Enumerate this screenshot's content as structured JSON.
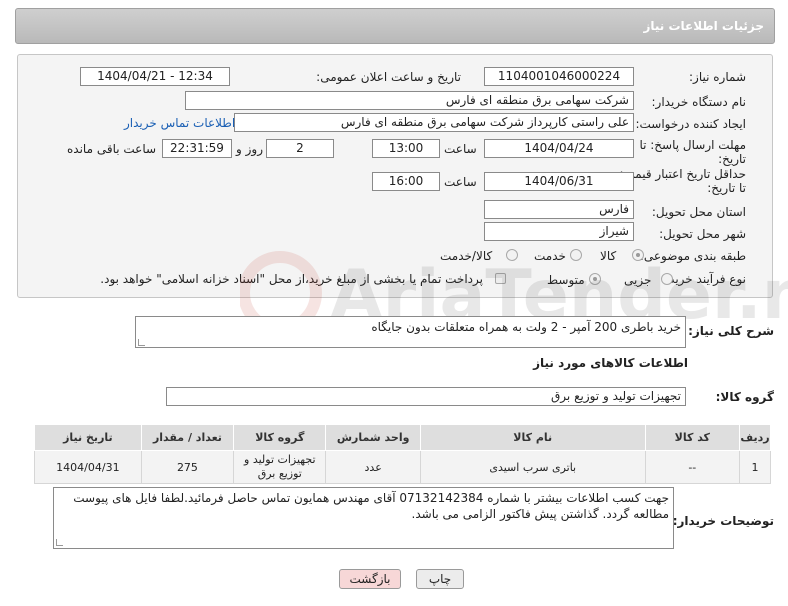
{
  "header": {
    "title": "جزئیات اطلاعات نیاز"
  },
  "form": {
    "need_number_label": "شماره نیاز:",
    "need_number": "1104001046000224",
    "announce_label": "تاریخ و ساعت اعلان عمومی:",
    "announce_value": "1404/04/21 - 12:34",
    "buyer_org_label": "نام دستگاه خریدار:",
    "buyer_org": "شرکت سهامی برق منطقه ای فارس",
    "creator_label": "ایجاد کننده درخواست:",
    "creator": "علی راستی کارپرداز شرکت سهامی برق منطقه ای فارس",
    "contact_link": "اطلاعات تماس خریدار",
    "deadline_label_1": "مهلت ارسال پاسخ: تا",
    "deadline_label_2": "تاریخ:",
    "deadline_date": "1404/04/24",
    "time_label": "ساعت",
    "deadline_time": "13:00",
    "days_value": "2",
    "days_label": "روز و",
    "remaining_time": "22:31:59",
    "remaining_label": "ساعت باقی مانده",
    "validity_label_1": "حداقل تاریخ اعتبار قیمت:",
    "validity_label_2": "تا تاریخ:",
    "validity_date": "1404/06/31",
    "validity_time": "16:00",
    "province_label": "استان محل تحویل:",
    "province": "فارس",
    "city_label": "شهر محل تحویل:",
    "city": "شیراز",
    "category_label": "طبقه بندی موضوعی:",
    "category_options": [
      "کالا",
      "خدمت",
      "کالا/خدمت"
    ],
    "process_label": "نوع فرآیند خرید :",
    "process_options": [
      "جزیی",
      "متوسط"
    ],
    "payment_note": "پرداخت تمام یا بخشی از مبلغ خرید،از محل \"اسناد خزانه اسلامی\" خواهد بود."
  },
  "summary": {
    "label": "شرح کلی نیاز:",
    "text": "خرید باطری 200 آمپر - 2 ولت به همراه متعلقات بدون جایگاه"
  },
  "goods": {
    "section_title": "اطلاعات کالاهای مورد نیاز",
    "group_label": "گروه کالا:",
    "group_value": "تجهیزات تولید و توزیع برق",
    "columns": [
      "ردیف",
      "کد کالا",
      "نام کالا",
      "واحد شمارش",
      "گروه کالا",
      "تعداد / مقدار",
      "تاریخ نیاز"
    ],
    "rows": [
      {
        "row": "1",
        "code": "--",
        "name": "باتری سرب اسیدی",
        "unit": "عدد",
        "group": "تجهیزات تولید و توزیع برق",
        "qty": "275",
        "date": "1404/04/31"
      }
    ]
  },
  "buyer_notes": {
    "label": "توضیحات خریدار:",
    "text": "جهت کسب اطلاعات بیشتر با شماره 07132142384 آقای مهندس همایون تماس حاصل فرمائید.لطفا فایل های پیوست مطالعه گردد. گذاشتن پیش فاکتور الزامی می باشد."
  },
  "buttons": {
    "print": "چاپ",
    "back": "بازگشت"
  },
  "colors": {
    "link": "#1a5fb4",
    "back_button": "#f7d7d7",
    "print_button": "#ececec"
  }
}
